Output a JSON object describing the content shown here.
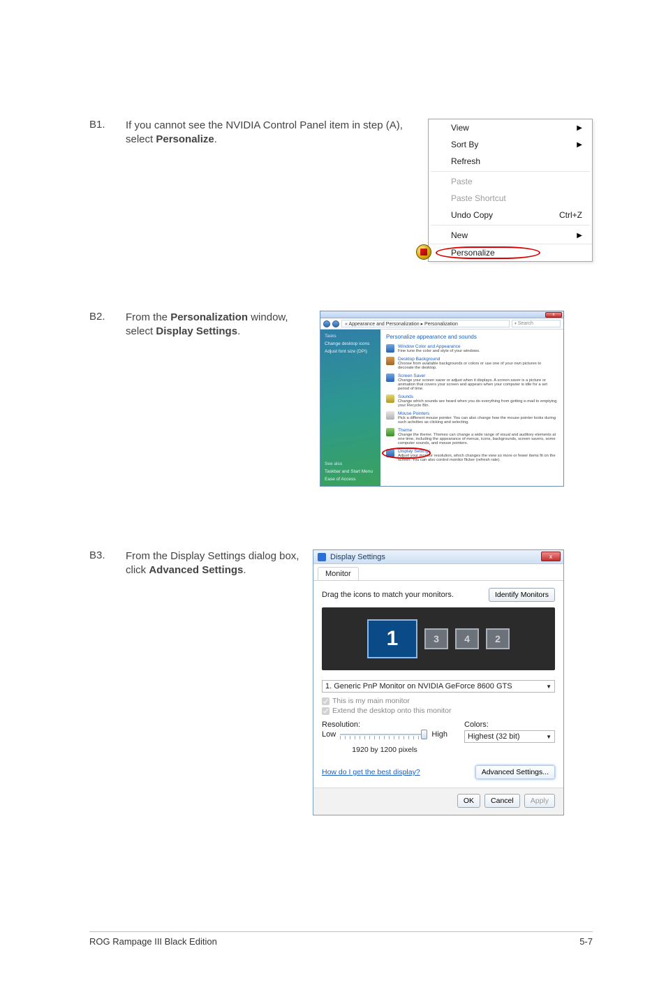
{
  "b1": {
    "label": "B1.",
    "text_before": "If you cannot see the NVIDIA Control Panel item in step (A), select ",
    "text_bold": "Personalize",
    "text_after": ".",
    "ctx": {
      "view": "View",
      "sort": "Sort By",
      "refresh": "Refresh",
      "paste": "Paste",
      "paste_sc": "Paste Shortcut",
      "undo": "Undo Copy",
      "undo_sc": "Ctrl+Z",
      "new": "New",
      "personalize": "Personalize"
    }
  },
  "b2": {
    "label": "B2.",
    "text_a": "From the ",
    "text_b": "Personalization",
    "text_c": " window, select ",
    "text_d": "Display Settings",
    "text_e": ".",
    "window": {
      "close": "x",
      "breadcrumb": "« Appearance and Personalization  ▸  Personalization",
      "search": "Search",
      "side": {
        "tasks": "Tasks",
        "change_icons": "Change desktop icons",
        "adjust_font": "Adjust font size (DPI)",
        "see_also": "See also",
        "taskbar": "Taskbar and Start Menu",
        "ease": "Ease of Access"
      },
      "heading": "Personalize appearance and sounds",
      "items": [
        {
          "title": "Window Color and Appearance",
          "desc": "Fine tune the color and style of your windows."
        },
        {
          "title": "Desktop Background",
          "desc": "Choose from available backgrounds or colors or use one of your own pictures to decorate the desktop."
        },
        {
          "title": "Screen Saver",
          "desc": "Change your screen saver or adjust when it displays. A screen saver is a picture or animation that covers your screen and appears when your computer is idle for a set period of time."
        },
        {
          "title": "Sounds",
          "desc": "Change which sounds are heard when you do everything from getting e-mail to emptying your Recycle Bin."
        },
        {
          "title": "Mouse Pointers",
          "desc": "Pick a different mouse pointer. You can also change how the mouse pointer looks during such activities as clicking and selecting."
        },
        {
          "title": "Theme",
          "desc": "Change the theme. Themes can change a wide range of visual and auditory elements at one time, including the appearance of menus, icons, backgrounds, screen savers, some computer sounds, and mouse pointers."
        },
        {
          "title": "Display Settings",
          "desc": "Adjust your monitor resolution, which changes the view so more or fewer items fit on the screen. You can also control monitor flicker (refresh rate)."
        }
      ]
    }
  },
  "b3": {
    "label": "B3.",
    "text_a": "From the Display Settings dialog box, click ",
    "text_b": "Advanced Settings",
    "text_c": ".",
    "dlg": {
      "title": "Display Settings",
      "close": "x",
      "tab": "Monitor",
      "drag_text": "Drag the icons to match your monitors.",
      "identify": "Identify Monitors",
      "mon1": "1",
      "mon3": "3",
      "mon4": "4",
      "mon2": "2",
      "dropdown": "1. Generic PnP Monitor on NVIDIA GeForce 8600 GTS",
      "chk_main": "This is my main monitor",
      "chk_extend": "Extend the desktop onto this monitor",
      "res_lbl": "Resolution:",
      "low": "Low",
      "high": "High",
      "res_val": "1920 by 1200 pixels",
      "colors_lbl": "Colors:",
      "colors_val": "Highest (32 bit)",
      "help_link": "How do I get the best display?",
      "adv": "Advanced Settings...",
      "ok": "OK",
      "cancel": "Cancel",
      "apply": "Apply"
    }
  },
  "footer": {
    "left": "ROG Rampage III Black Edition",
    "right": "5-7"
  }
}
